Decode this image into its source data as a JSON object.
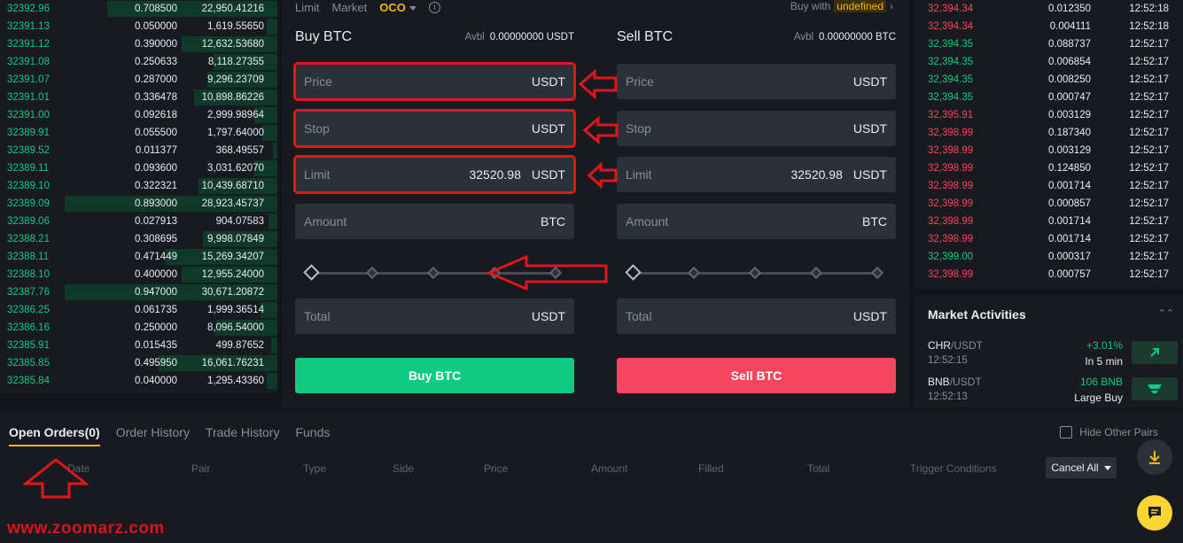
{
  "orderbook": [
    {
      "price": "32392.96",
      "amount": "0.708500",
      "total": "22,950.41216",
      "depth": 0.8
    },
    {
      "price": "32391.13",
      "amount": "0.050000",
      "total": "1,619.55650",
      "depth": 0.05
    },
    {
      "price": "32391.12",
      "amount": "0.390000",
      "total": "12,632.53680",
      "depth": 0.45
    },
    {
      "price": "32391.08",
      "amount": "0.250633",
      "total": "8,118.27355",
      "depth": 0.3
    },
    {
      "price": "32391.07",
      "amount": "0.287000",
      "total": "9,296.23709",
      "depth": 0.33
    },
    {
      "price": "32391.01",
      "amount": "0.336478",
      "total": "10,898.86226",
      "depth": 0.39
    },
    {
      "price": "32391.00",
      "amount": "0.092618",
      "total": "2,999.98964",
      "depth": 0.11
    },
    {
      "price": "32389.91",
      "amount": "0.055500",
      "total": "1,797.64000",
      "depth": 0.07
    },
    {
      "price": "32389.52",
      "amount": "0.011377",
      "total": "368.49557",
      "depth": 0.02
    },
    {
      "price": "32389.11",
      "amount": "0.093600",
      "total": "3,031.62070",
      "depth": 0.11
    },
    {
      "price": "32389.10",
      "amount": "0.322321",
      "total": "10,439.68710",
      "depth": 0.37
    },
    {
      "price": "32389.09",
      "amount": "0.893000",
      "total": "28,923.45737",
      "depth": 1.0
    },
    {
      "price": "32389.06",
      "amount": "0.027913",
      "total": "904.07583",
      "depth": 0.04
    },
    {
      "price": "32388.21",
      "amount": "0.308695",
      "total": "9,998.07849",
      "depth": 0.35
    },
    {
      "price": "32388.11",
      "amount": "0.471449",
      "total": "15,269.34207",
      "depth": 0.53
    },
    {
      "price": "32388.10",
      "amount": "0.400000",
      "total": "12,955.24000",
      "depth": 0.45
    },
    {
      "price": "32387.76",
      "amount": "0.947000",
      "total": "30,671.20872",
      "depth": 1.0
    },
    {
      "price": "32386.25",
      "amount": "0.061735",
      "total": "1,999.36514",
      "depth": 0.08
    },
    {
      "price": "32386.16",
      "amount": "0.250000",
      "total": "8,096.54000",
      "depth": 0.29
    },
    {
      "price": "32385.91",
      "amount": "0.015435",
      "total": "499.87652",
      "depth": 0.03
    },
    {
      "price": "32385.85",
      "amount": "0.495950",
      "total": "16,061.76231",
      "depth": 0.56
    },
    {
      "price": "32385.84",
      "amount": "0.040000",
      "total": "1,295.43360",
      "depth": 0.05
    }
  ],
  "form": {
    "tabs": [
      "Limit",
      "Market",
      "OCO"
    ],
    "active_tab": "OCO",
    "buy_with_label": "Buy with",
    "buy_with_value": "undefined",
    "buy": {
      "title": "Buy BTC",
      "avbl_label": "Avbl",
      "avbl_value": "0.00000000 USDT",
      "price_label": "Price",
      "price_unit": "USDT",
      "stop_label": "Stop",
      "stop_unit": "USDT",
      "limit_label": "Limit",
      "limit_value": "32520.98",
      "limit_unit": "USDT",
      "amount_label": "Amount",
      "amount_unit": "BTC",
      "total_label": "Total",
      "total_unit": "USDT",
      "button": "Buy BTC"
    },
    "sell": {
      "title": "Sell BTC",
      "avbl_label": "Avbl",
      "avbl_value": "0.00000000 BTC",
      "price_label": "Price",
      "price_unit": "USDT",
      "stop_label": "Stop",
      "stop_unit": "USDT",
      "limit_label": "Limit",
      "limit_value": "32520.98",
      "limit_unit": "USDT",
      "amount_label": "Amount",
      "amount_unit": "BTC",
      "total_label": "Total",
      "total_unit": "USDT",
      "button": "Sell BTC"
    },
    "slider_percent": 0
  },
  "trades": [
    {
      "price": "32,394.34",
      "dir": "down",
      "amount": "0.012350",
      "time": "12:52:18"
    },
    {
      "price": "32,394.34",
      "dir": "down",
      "amount": "0.004111",
      "time": "12:52:18"
    },
    {
      "price": "32,394.35",
      "dir": "up",
      "amount": "0.088737",
      "time": "12:52:17"
    },
    {
      "price": "32,394.35",
      "dir": "up",
      "amount": "0.006854",
      "time": "12:52:17"
    },
    {
      "price": "32,394.35",
      "dir": "up",
      "amount": "0.008250",
      "time": "12:52:17"
    },
    {
      "price": "32,394.35",
      "dir": "up",
      "amount": "0.000747",
      "time": "12:52:17"
    },
    {
      "price": "32,395.91",
      "dir": "down",
      "amount": "0.003129",
      "time": "12:52:17"
    },
    {
      "price": "32,398.99",
      "dir": "down",
      "amount": "0.187340",
      "time": "12:52:17"
    },
    {
      "price": "32,398.99",
      "dir": "down",
      "amount": "0.003129",
      "time": "12:52:17"
    },
    {
      "price": "32,398.99",
      "dir": "down",
      "amount": "0.124850",
      "time": "12:52:17"
    },
    {
      "price": "32,398.99",
      "dir": "down",
      "amount": "0.001714",
      "time": "12:52:17"
    },
    {
      "price": "32,398.99",
      "dir": "down",
      "amount": "0.000857",
      "time": "12:52:17"
    },
    {
      "price": "32,398.99",
      "dir": "down",
      "amount": "0.001714",
      "time": "12:52:17"
    },
    {
      "price": "32,398.99",
      "dir": "down",
      "amount": "0.001714",
      "time": "12:52:17"
    },
    {
      "price": "32,399.00",
      "dir": "up",
      "amount": "0.000317",
      "time": "12:52:17"
    },
    {
      "price": "32,398.99",
      "dir": "down",
      "amount": "0.000757",
      "time": "12:52:17"
    }
  ],
  "activities": {
    "title": "Market Activities",
    "items": [
      {
        "base": "CHR",
        "quote": "/USDT",
        "time": "12:52:15",
        "change": "+3.01%",
        "desc": "In 5 min",
        "icon": "trend-up-icon"
      },
      {
        "base": "BNB",
        "quote": "/USDT",
        "time": "12:52:13",
        "change": "106 BNB",
        "desc": "Large Buy",
        "icon": "large-buy-icon"
      }
    ]
  },
  "orders": {
    "tabs": [
      "Open Orders(0)",
      "Order History",
      "Trade History",
      "Funds"
    ],
    "active_tab": "Open Orders(0)",
    "hide_pairs": "Hide Other Pairs",
    "columns": [
      "Date",
      "Pair",
      "Type",
      "Side",
      "Price",
      "Amount",
      "Filled",
      "Total",
      "Trigger Conditions"
    ],
    "cancel_all": "Cancel All"
  },
  "watermark": "www.zoomarz.com",
  "colors": {
    "up": "#0ecb81",
    "down": "#f6465d",
    "accent": "#f0b90b",
    "annotation": "#e0161e"
  }
}
